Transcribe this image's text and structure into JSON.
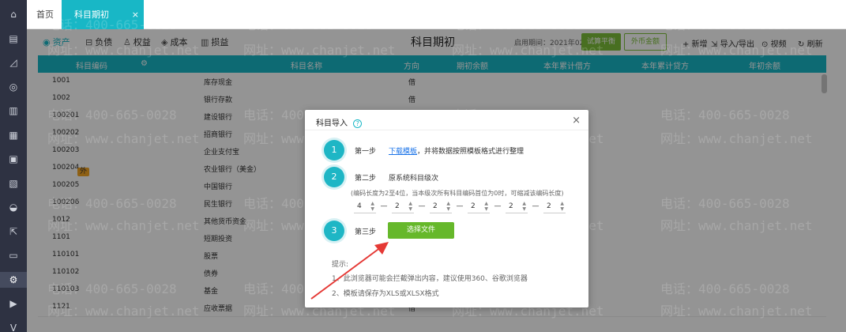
{
  "rail": {
    "icons": [
      "home-icon",
      "document-icon",
      "chart-icon",
      "money-bag-icon",
      "ledger-icon",
      "report-icon",
      "gift-icon",
      "invoice-icon",
      "tea-icon",
      "export-icon",
      "inbox-icon",
      "settings-icon",
      "media-icon",
      "vee-icon"
    ],
    "active_index": 11
  },
  "tabs": {
    "home": "首页",
    "current": "科目期初",
    "close": "×"
  },
  "toolbar": {
    "tabs": [
      {
        "glyph": "◉",
        "label": "资产"
      },
      {
        "glyph": "⊟",
        "label": "负债"
      },
      {
        "glyph": "♙",
        "label": "权益"
      },
      {
        "glyph": "◈",
        "label": "成本"
      },
      {
        "glyph": "▥",
        "label": "损益"
      }
    ],
    "title": "科目期初",
    "period": "启用期间：2021年02月",
    "trial_balance": "试算平衡",
    "fx": "外币金额",
    "add": "+ 新增",
    "import_export": "导入/导出",
    "video": "视频",
    "refresh": "刷新"
  },
  "table": {
    "headers": {
      "code": "科目编码",
      "name": "科目名称",
      "direction": "方向",
      "opening": "期初余额",
      "ytd_debit": "本年累计借方",
      "ytd_credit": "本年累计贷方",
      "year_opening": "年初余额"
    },
    "rows": [
      {
        "code": "1001",
        "name": "库存现金",
        "dir": "借",
        "badge": ""
      },
      {
        "code": "1002",
        "name": "银行存款",
        "dir": "借",
        "badge": ""
      },
      {
        "code": "100201",
        "name": "建设银行",
        "dir": "",
        "badge": ""
      },
      {
        "code": "100202",
        "name": "招商银行",
        "dir": "",
        "badge": ""
      },
      {
        "code": "100203",
        "name": "企业支付宝",
        "dir": "",
        "badge": ""
      },
      {
        "code": "100204",
        "name": "农业银行（美金）",
        "dir": "",
        "badge": "外"
      },
      {
        "code": "100205",
        "name": "中国银行",
        "dir": "",
        "badge": ""
      },
      {
        "code": "100206",
        "name": "民生银行",
        "dir": "",
        "badge": ""
      },
      {
        "code": "1012",
        "name": "其他货币资金",
        "dir": "",
        "badge": ""
      },
      {
        "code": "1101",
        "name": "短期投资",
        "dir": "",
        "badge": ""
      },
      {
        "code": "110101",
        "name": "股票",
        "dir": "",
        "badge": ""
      },
      {
        "code": "110102",
        "name": "债券",
        "dir": "",
        "badge": ""
      },
      {
        "code": "110103",
        "name": "基金",
        "dir": "",
        "badge": ""
      },
      {
        "code": "1121",
        "name": "应收票据",
        "dir": "借",
        "badge": ""
      }
    ]
  },
  "watermark": {
    "phone": "电话：400-665-0028",
    "site": "网址：www.chanjet.net"
  },
  "modal": {
    "title": "科目导入",
    "help": "?",
    "close": "×",
    "steps": [
      {
        "num": "1",
        "label": "第一步",
        "link": "下载模板",
        "text": "，并将数据按照模板格式进行整理"
      },
      {
        "num": "2",
        "label": "第二步",
        "text": "原系统科目级次"
      },
      {
        "num": "3",
        "label": "第三步",
        "button": "选择文件"
      }
    ],
    "hint": "(编码长度为2至4位，当本级次所有科目编码首位为0时，可缩减该编码长度)",
    "levels": [
      "4",
      "2",
      "2",
      "2",
      "2",
      "2"
    ],
    "separator": "—",
    "tips_title": "提示:",
    "tips": [
      "1、此浏览器可能会拦截弹出内容，建议使用360、谷歌浏览器",
      "2、模板请保存为XLS或XLSX格式"
    ]
  },
  "colors": {
    "accent": "#18b7c6",
    "button_green": "#66b82b",
    "arrow": "#e53935"
  }
}
